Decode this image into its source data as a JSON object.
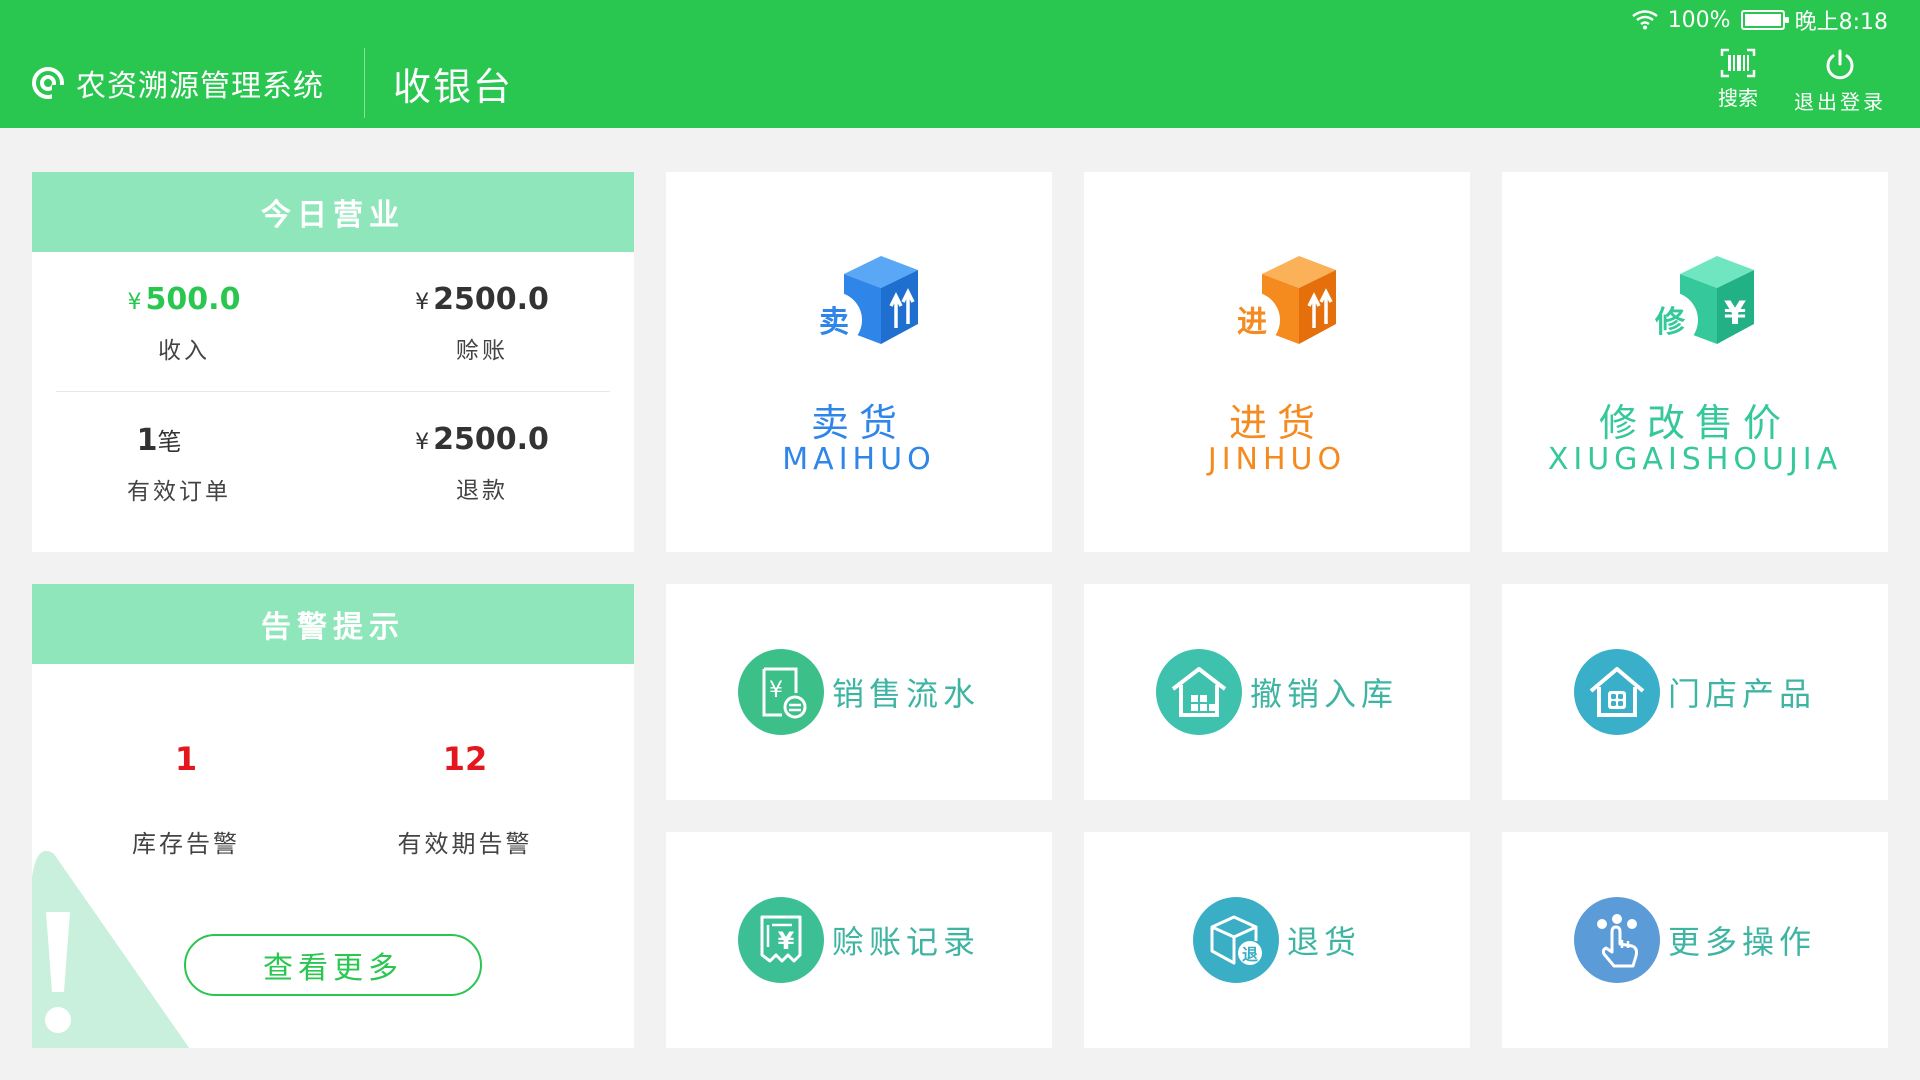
{
  "status_bar": {
    "battery": "100%",
    "time": "晚上8:18",
    "battery_level": 1.0
  },
  "header": {
    "app_name": "农资溯源管理系统",
    "page_title": "收银台",
    "search_label": "搜索",
    "logout_label": "退出登录"
  },
  "today": {
    "title": "今日营业",
    "currency": "¥",
    "income_value": "500.0",
    "income_label": "收入",
    "credit_value": "2500.0",
    "credit_label": "赊账",
    "orders_value": "1",
    "orders_unit": "笔",
    "orders_label": "有效订单",
    "refund_value": "2500.0",
    "refund_label": "退款"
  },
  "alerts": {
    "title": "告警提示",
    "stock_count": "1",
    "stock_label": "库存告警",
    "expiry_count": "12",
    "expiry_label": "有效期告警",
    "more_label": "查看更多"
  },
  "tiles_big": [
    {
      "cn": "卖货",
      "en": "MAIHUO",
      "badge": "卖",
      "color": "#2f86e8",
      "icon": "box-sell-icon"
    },
    {
      "cn": "进货",
      "en": "JINHUO",
      "badge": "进",
      "color": "#f58a1f",
      "icon": "box-purchase-icon"
    },
    {
      "cn": "修改售价",
      "en": "XIUGAISHOUJIA",
      "badge": "修",
      "color": "#35c89a",
      "icon": "box-price-icon"
    }
  ],
  "tiles_small": [
    {
      "label": "销售流水",
      "icon": "receipt-icon"
    },
    {
      "label": "撤销入库",
      "icon": "warehouse-icon"
    },
    {
      "label": "门店产品",
      "icon": "store-icon"
    },
    {
      "label": "赊账记录",
      "icon": "credit-record-icon"
    },
    {
      "label": "退货",
      "icon": "return-box-icon"
    },
    {
      "label": "更多操作",
      "icon": "hand-tap-icon"
    }
  ]
}
